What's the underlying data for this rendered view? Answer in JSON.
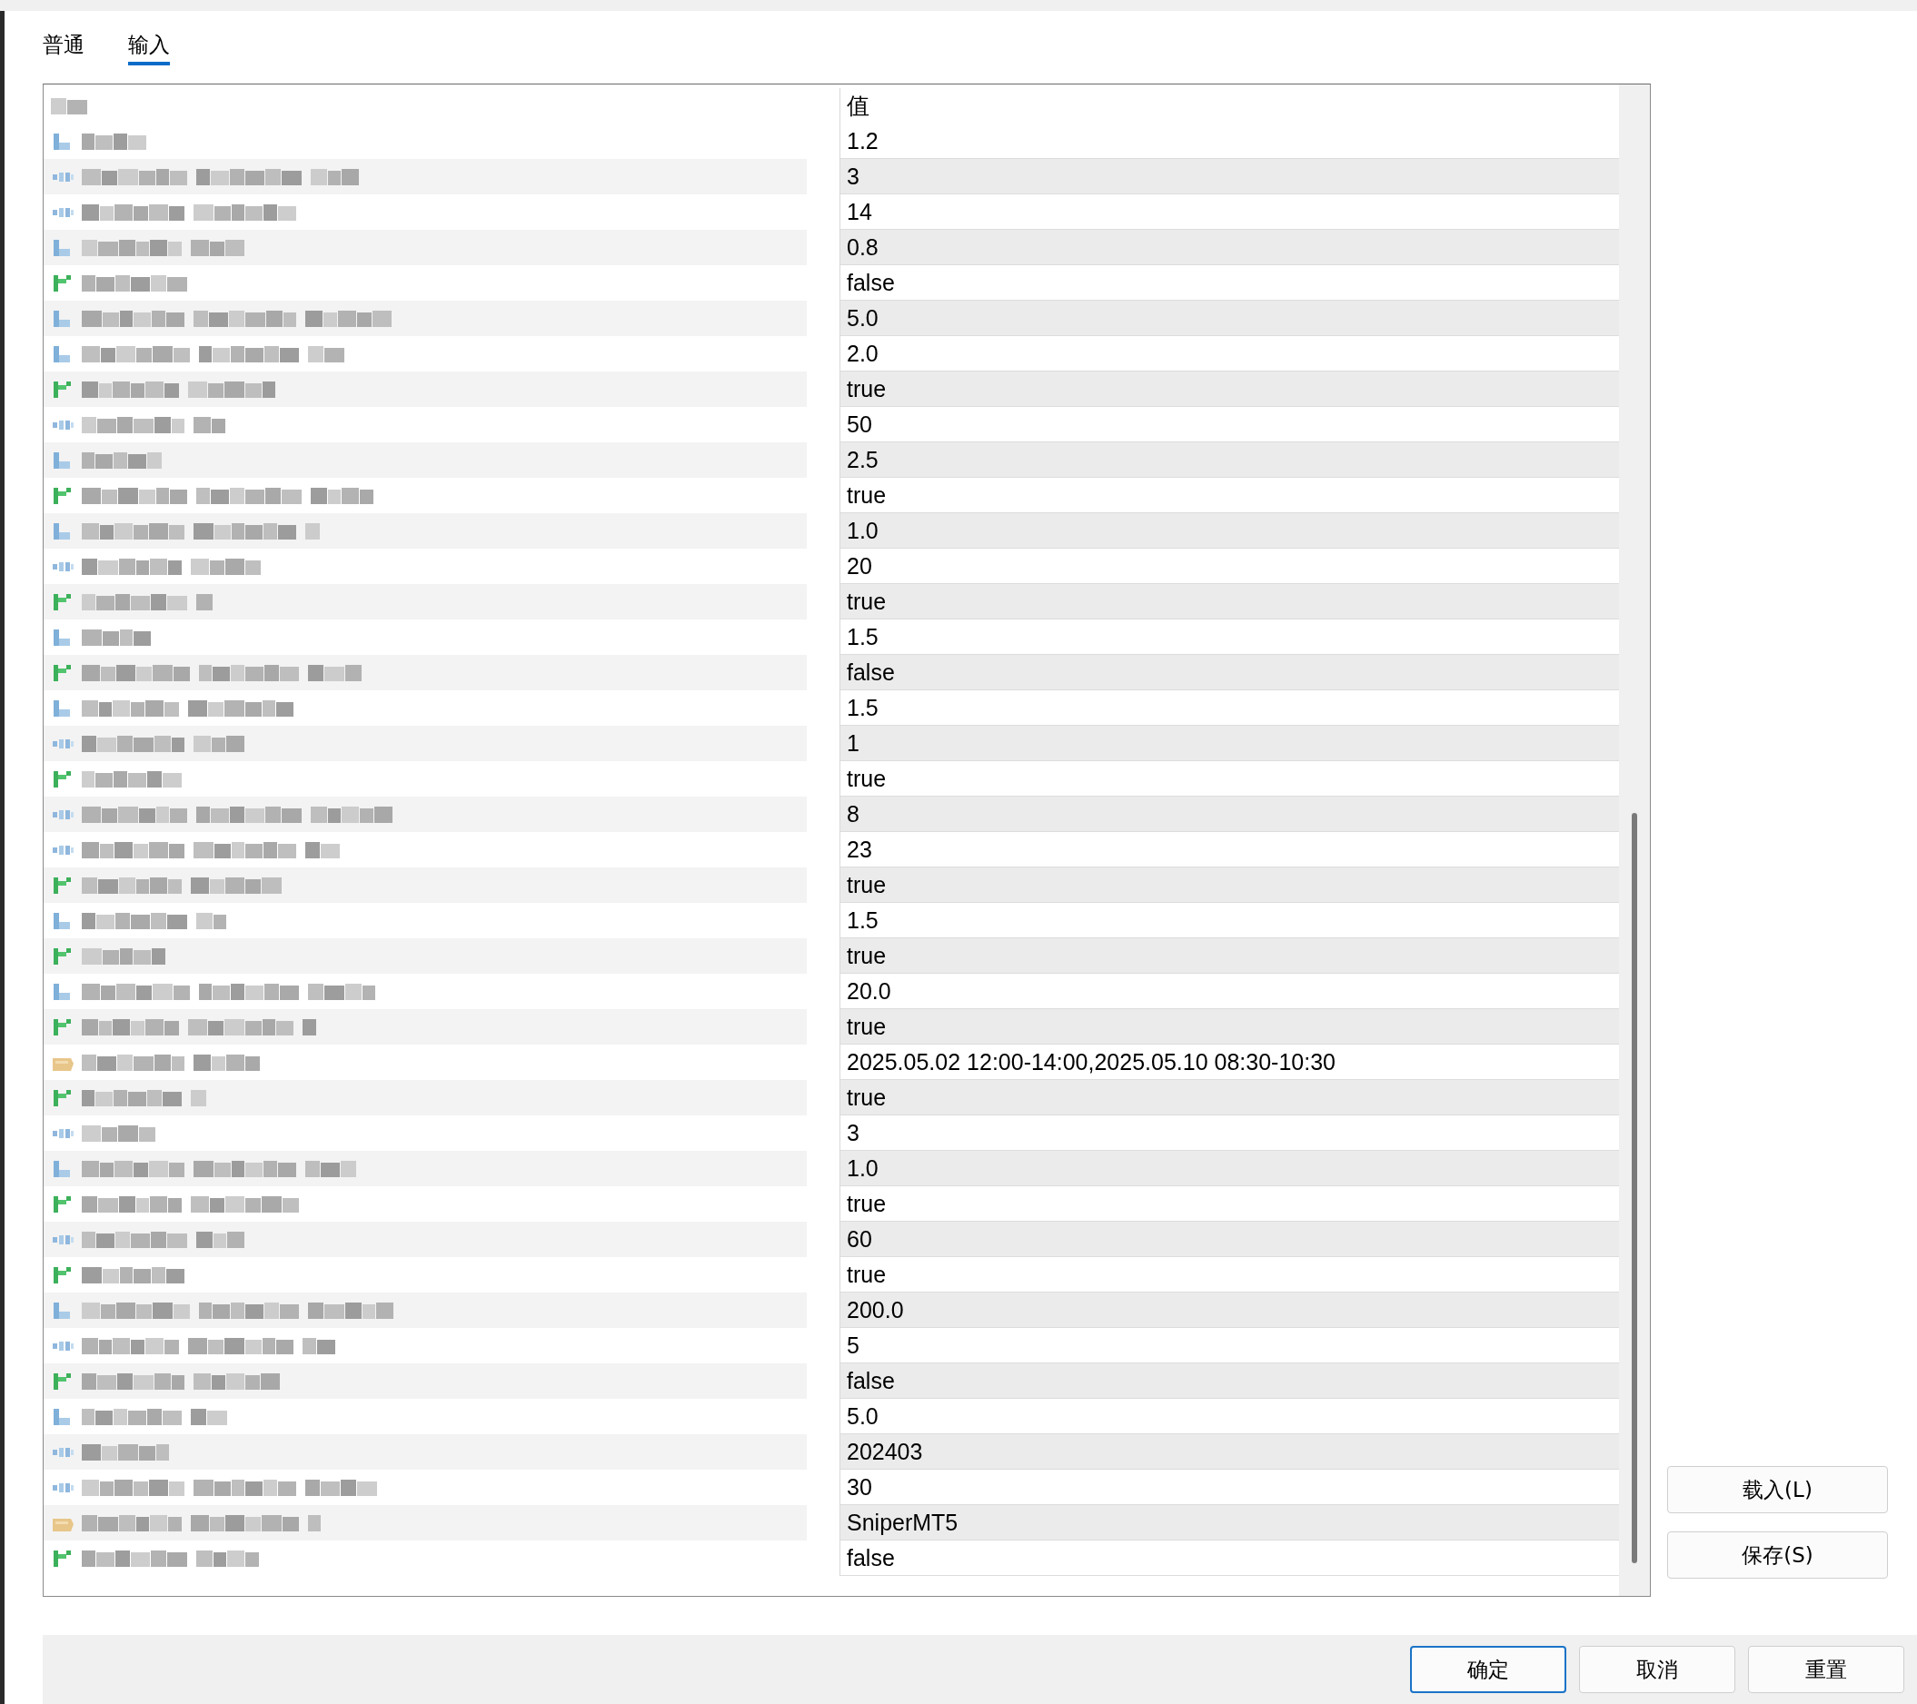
{
  "tabs": [
    {
      "label": "普通",
      "selected": false
    },
    {
      "label": "输入",
      "selected": true
    }
  ],
  "table": {
    "value_header": "值",
    "rows": [
      {
        "kind": "double",
        "value": "1.2"
      },
      {
        "kind": "int",
        "value": "3"
      },
      {
        "kind": "int",
        "value": "14"
      },
      {
        "kind": "double",
        "value": "0.8"
      },
      {
        "kind": "bool",
        "value": "false"
      },
      {
        "kind": "double",
        "value": "5.0"
      },
      {
        "kind": "double",
        "value": "2.0"
      },
      {
        "kind": "bool",
        "value": "true"
      },
      {
        "kind": "int",
        "value": "50"
      },
      {
        "kind": "double",
        "value": "2.5"
      },
      {
        "kind": "bool",
        "value": "true"
      },
      {
        "kind": "double",
        "value": "1.0"
      },
      {
        "kind": "int",
        "value": "20"
      },
      {
        "kind": "bool",
        "value": "true"
      },
      {
        "kind": "double",
        "value": "1.5"
      },
      {
        "kind": "bool",
        "value": "false"
      },
      {
        "kind": "double",
        "value": "1.5"
      },
      {
        "kind": "int",
        "value": "1"
      },
      {
        "kind": "bool",
        "value": "true"
      },
      {
        "kind": "int",
        "value": "8"
      },
      {
        "kind": "int",
        "value": "23"
      },
      {
        "kind": "bool",
        "value": "true"
      },
      {
        "kind": "double",
        "value": "1.5"
      },
      {
        "kind": "bool",
        "value": "true"
      },
      {
        "kind": "double",
        "value": "20.0"
      },
      {
        "kind": "bool",
        "value": "true"
      },
      {
        "kind": "string",
        "value": "2025.05.02 12:00-14:00,2025.05.10 08:30-10:30"
      },
      {
        "kind": "bool",
        "value": "true"
      },
      {
        "kind": "int",
        "value": "3"
      },
      {
        "kind": "double",
        "value": "1.0"
      },
      {
        "kind": "bool",
        "value": "true"
      },
      {
        "kind": "int",
        "value": "60"
      },
      {
        "kind": "bool",
        "value": "true"
      },
      {
        "kind": "double",
        "value": "200.0"
      },
      {
        "kind": "int",
        "value": "5"
      },
      {
        "kind": "bool",
        "value": "false"
      },
      {
        "kind": "double",
        "value": "5.0"
      },
      {
        "kind": "int",
        "value": "202403"
      },
      {
        "kind": "int",
        "value": "30"
      },
      {
        "kind": "string",
        "value": "SniperMT5"
      },
      {
        "kind": "bool",
        "value": "false"
      }
    ]
  },
  "side_buttons": [
    "载入(L)",
    "保存(S)"
  ],
  "footer_buttons": [
    {
      "label": "确定",
      "default": true
    },
    {
      "label": "取消",
      "default": false
    },
    {
      "label": "重置",
      "default": false
    }
  ]
}
